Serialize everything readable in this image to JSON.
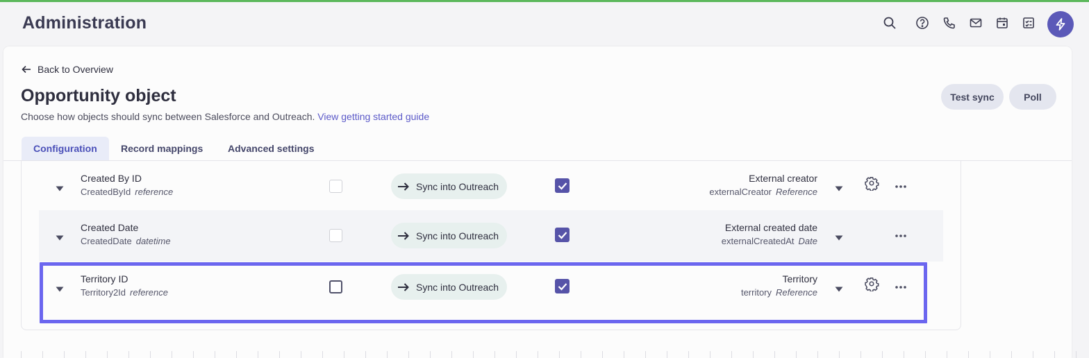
{
  "header": {
    "app_title": "Administration",
    "icons": [
      "search-icon",
      "help-icon",
      "phone-icon",
      "mail-icon",
      "calendar-icon",
      "tasks-icon",
      "bolt-icon"
    ]
  },
  "nav": {
    "back_label": "Back to Overview"
  },
  "page": {
    "title": "Opportunity object",
    "subtitle": "Choose how objects should sync between Salesforce and Outreach.",
    "guide_link": "View getting started guide",
    "test_sync_label": "Test sync",
    "poll_label": "Poll"
  },
  "tabs": [
    {
      "label": "Configuration",
      "active": true
    },
    {
      "label": "Record mappings",
      "active": false
    },
    {
      "label": "Advanced settings",
      "active": false
    }
  ],
  "rows": [
    {
      "field_name": "Created By ID",
      "field_api": "CreatedById",
      "field_type": "reference",
      "sync_label": "Sync into Outreach",
      "ext_name": "External creator",
      "ext_api": "externalCreator",
      "ext_type": "Reference",
      "has_gear": true
    },
    {
      "field_name": "Created Date",
      "field_api": "CreatedDate",
      "field_type": "datetime",
      "sync_label": "Sync into Outreach",
      "ext_name": "External created date",
      "ext_api": "externalCreatedAt",
      "ext_type": "Date",
      "has_gear": false
    },
    {
      "field_name": "Territory ID",
      "field_api": "Territory2Id",
      "field_type": "reference",
      "sync_label": "Sync into Outreach",
      "ext_name": "Territory",
      "ext_api": "territory",
      "ext_type": "Reference",
      "has_gear": true
    }
  ],
  "colors": {
    "accent": "#5b59b8",
    "highlight": "#6b66ef",
    "top_line": "#5cb85c"
  }
}
